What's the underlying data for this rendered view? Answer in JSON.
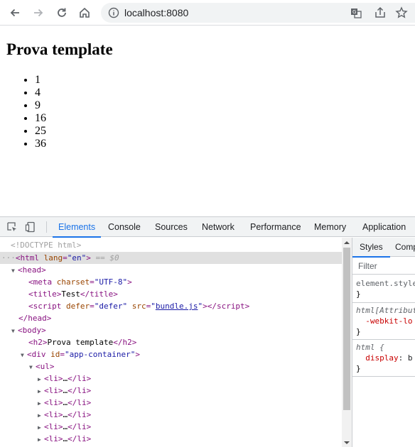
{
  "browser": {
    "url": "localhost:8080",
    "icons": [
      "back-arrow-icon",
      "forward-arrow-icon",
      "reload-icon",
      "home-icon",
      "info-icon",
      "translate-icon",
      "share-icon",
      "bookmark-star-icon"
    ]
  },
  "page": {
    "heading": "Prova template",
    "list": [
      "1",
      "4",
      "9",
      "16",
      "25",
      "36"
    ]
  },
  "devtools": {
    "tabs": [
      "Elements",
      "Console",
      "Sources",
      "Network",
      "Performance",
      "Memory",
      "Application"
    ],
    "active_tab": "Elements",
    "dom": {
      "doctype": "<!DOCTYPE html>",
      "html_open": "<html lang=\"en\">",
      "selected_marker": "== $0",
      "lang_attr": "lang",
      "lang_val": "\"en\"",
      "meta_charset_val": "\"UTF-8\"",
      "title_text": "Test",
      "script_defer_val": "\"defer\"",
      "script_src": "bundle.js",
      "h2_text": "Prova template",
      "div_id": "\"app-container\"",
      "li_collapsed": "…"
    },
    "styles_pane": {
      "tabs": [
        "Styles",
        "Comp"
      ],
      "filter_placeholder": "Filter",
      "rules": [
        {
          "selector": "element.style",
          "body": "}"
        },
        {
          "selector": "html[Attribut",
          "prop": "-webkit-lo",
          "close": "}"
        },
        {
          "selector": "html {",
          "prop": "display",
          "value": "b",
          "close": "}"
        }
      ]
    }
  },
  "colors": {
    "accent": "#1a73e8",
    "tag": "#881280",
    "attr": "#994500",
    "attr_value": "#1a1aa6"
  }
}
